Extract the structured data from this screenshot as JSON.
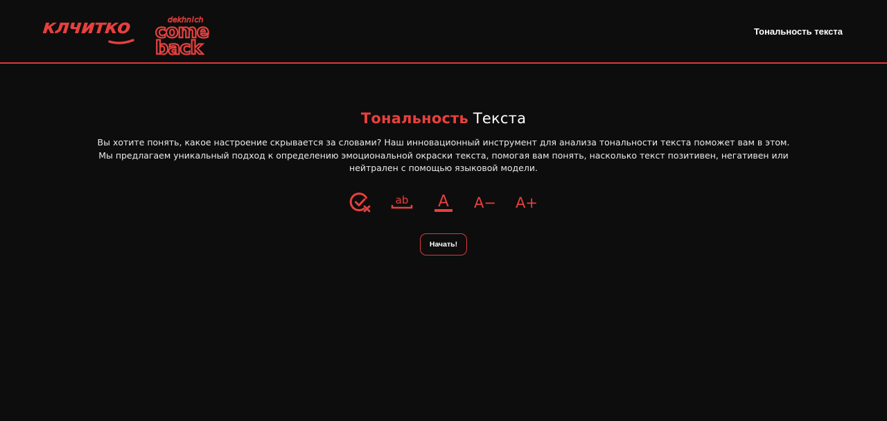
{
  "header": {
    "logo_primary_text": "клчитко",
    "logo_secondary_text": "come back",
    "logo_secondary_small_text": "dekhn!ch",
    "nav_link_label": "Тональность текста"
  },
  "hero": {
    "title_accent": "Тональность",
    "title_rest": "Текста",
    "description_line1": "Вы хотите понять, какое настроение скрывается за словами? Наш инновационный инструмент для анализа тональности текста поможет вам в этом.",
    "description_line2": "Мы предлагаем уникальный подход к определению эмоциональной окраски текста, помогая вам понять, насколько текст позитивен, негативен или нейтрален с помощью языковой модели."
  },
  "feature_icons": [
    {
      "icon": "check-cross-circle-icon"
    },
    {
      "icon": "text-underline-ab-icon"
    },
    {
      "icon": "text-color-icon"
    },
    {
      "icon": "font-decrease-icon",
      "label": "A−"
    },
    {
      "icon": "font-increase-icon",
      "label": "A+"
    }
  ],
  "actions": {
    "start_button_label": "Начать!"
  },
  "colors": {
    "background": "#0d0d0d",
    "accent": "#e8403d",
    "text": "#ffffff"
  }
}
